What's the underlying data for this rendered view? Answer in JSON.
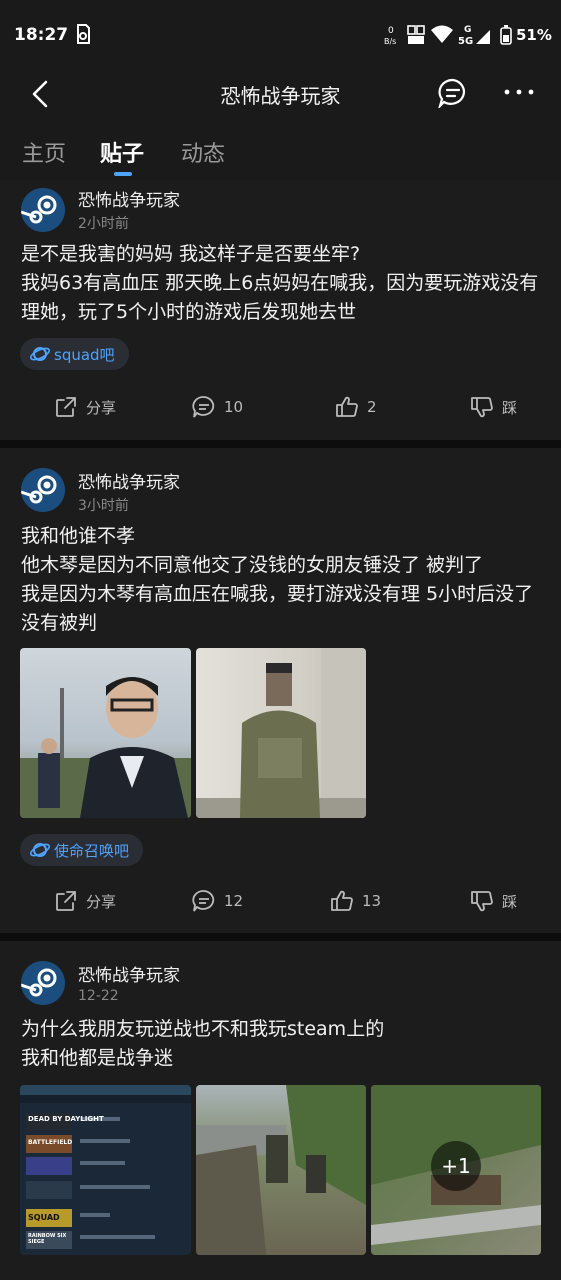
{
  "status_bar": {
    "time": "18:27",
    "battery": "51%",
    "net_speed": "0\nB/s",
    "network": "5G"
  },
  "header": {
    "title": "恐怖战争玩家"
  },
  "tabs": [
    {
      "label": "主页"
    },
    {
      "label": "贴子"
    },
    {
      "label": "动态"
    }
  ],
  "colors": {
    "accent": "#4fa3ff",
    "background": "#1c1c1c",
    "separator": "#0d0d0d"
  },
  "posts": [
    {
      "author": "恐怖战争玩家",
      "time": "2小时前",
      "text": "是不是我害的妈妈 我这样子是否要坐牢?\n我妈63有高血压 那天晚上6点妈妈在喊我，因为要玩游戏没有理她，玩了5个小时的游戏后发现她去世",
      "tag": "squad吧",
      "actions": {
        "share": "分享",
        "comments": "10",
        "likes": "2",
        "dislike": "踩"
      }
    },
    {
      "author": "恐怖战争玩家",
      "time": "3小时前",
      "text": "我和他谁不孝\n他木琴是因为不同意他交了没钱的女朋友锤没了 被判了\n我是因为木琴有高血压在喊我，要打游戏没有理 5小时后没了 没有被判",
      "tag": "使命召唤吧",
      "actions": {
        "share": "分享",
        "comments": "12",
        "likes": "13",
        "dislike": "踩"
      }
    },
    {
      "author": "恐怖战争玩家",
      "time": "12-22",
      "text": "为什么我朋友玩逆战也不和我玩steam上的\n我和他都是战争迷",
      "more_images": "+1",
      "steam_games": [
        "DEAD BY DAYLIGHT",
        "BATTLEFIELD",
        "",
        "",
        "SQUAD",
        "RAINBOW SIX SIEGE"
      ]
    }
  ]
}
